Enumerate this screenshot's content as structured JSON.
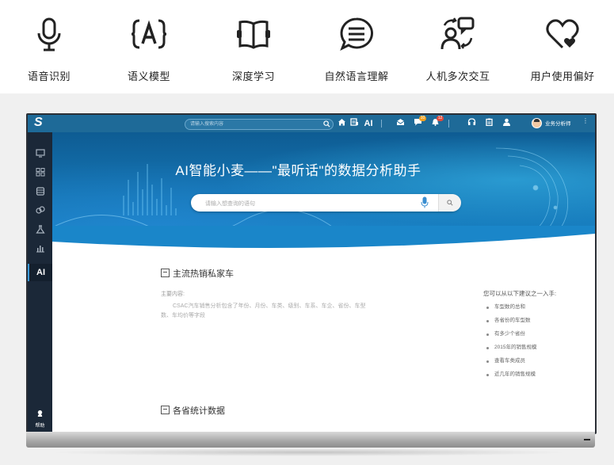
{
  "features": [
    {
      "icon": "microphone-icon",
      "label": "语音识别"
    },
    {
      "icon": "ai-bracket-icon",
      "label": "语义模型"
    },
    {
      "icon": "open-book-icon",
      "label": "深度学习"
    },
    {
      "icon": "speech-bubble-icon",
      "label": "自然语言理解"
    },
    {
      "icon": "human-machine-icon",
      "label": "人机多次交互"
    },
    {
      "icon": "heart-icon",
      "label": "用户使用偏好"
    }
  ],
  "app": {
    "logo": "S",
    "top_search_placeholder": "请输入搜索内容",
    "toolbar_ai": "AI",
    "badge_messages": "10",
    "badge_alerts": "12",
    "username": "业务分析师",
    "more": "⋮"
  },
  "sidebar": {
    "items": [
      {
        "icon": "monitor-icon"
      },
      {
        "icon": "grid-icon"
      },
      {
        "icon": "database-icon"
      },
      {
        "icon": "cubes-icon"
      },
      {
        "icon": "flask-icon"
      },
      {
        "icon": "bar-chart-icon"
      }
    ],
    "active_label": "AI",
    "help_label": "帮助"
  },
  "hero": {
    "title": "AI智能小麦——\"最听话\"的数据分析助手",
    "search_placeholder": "请输入想查询的语句"
  },
  "card1": {
    "title": "主流热销私家车",
    "desc_label": "主要内容:",
    "desc_line1": "CSAC汽车销售分析包含了年份、月份、车类、级别、车系、车企、省份、车型",
    "desc_line2": "数、车均价等字段",
    "suggest_title": "您可以从以下建议之一入手:",
    "suggestions": [
      "车型数的总和",
      "各省份的车型数",
      "有多少个省份",
      "2015年的销售规模",
      "查看车类成员",
      "近几年的销售规模"
    ]
  },
  "card2": {
    "title": "各省统计数据"
  },
  "colors": {
    "topbar": "#1e6a98",
    "sidebar": "#1b2838",
    "hero_start": "#0e5c93",
    "hero_end": "#1a86c9"
  }
}
